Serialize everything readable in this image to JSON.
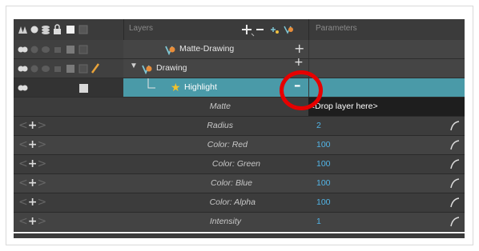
{
  "header": {
    "layers_title": "Layers",
    "parameters_title": "Parameters",
    "add_icon": "plus-icon",
    "remove_icon": "minus-icon"
  },
  "layers": [
    {
      "name": "Matte-Drawing",
      "expand": "",
      "action": "+"
    },
    {
      "name": "Drawing",
      "expand": "▼",
      "action": "+"
    },
    {
      "name": "Highlight",
      "expand": "",
      "action": "–"
    }
  ],
  "parameters": [
    {
      "label": "Matte",
      "value": "<Drop layer here>"
    },
    {
      "label": "Radius",
      "value": "2"
    },
    {
      "label": "Color: Red",
      "value": "100"
    },
    {
      "label": "Color: Green",
      "value": "100"
    },
    {
      "label": "Color: Blue",
      "value": "100"
    },
    {
      "label": "Color: Alpha",
      "value": "100"
    },
    {
      "label": "Intensity",
      "value": "1"
    }
  ],
  "colors": {
    "accent": "#4a9aa8",
    "value_text": "#52b4e6",
    "highlight_circle": "#e60000"
  }
}
